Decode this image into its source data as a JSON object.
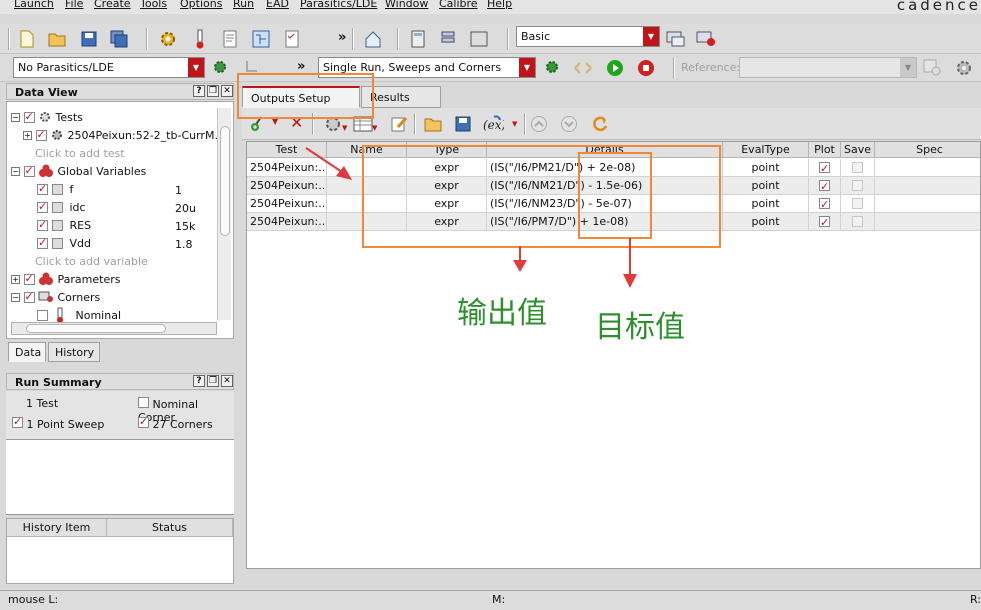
{
  "menu": [
    "Launch",
    "File",
    "Create",
    "Tools",
    "Options",
    "Run",
    "EAD",
    "Parasitics/LDE",
    "Window",
    "Calibre",
    "Help"
  ],
  "brand": "cadence",
  "toolbar1": {
    "more": "»",
    "mode_select": "Basic"
  },
  "toolbar2": {
    "parasitics_select": "No Parasitics/LDE",
    "more": "»",
    "run_select": "Single Run, Sweeps and Corners",
    "reference_label": "Reference:",
    "reference_value": ""
  },
  "data_view": {
    "title": "Data View",
    "ctrl_help": "?",
    "tests_label": "Tests",
    "test_name": "2504Peixun:52-2_tb-CurrM...",
    "add_test": "Click to add test",
    "global_vars_label": "Global Variables",
    "variables": [
      {
        "name": "f",
        "value": "1"
      },
      {
        "name": "idc",
        "value": "20u"
      },
      {
        "name": "RES",
        "value": "15k"
      },
      {
        "name": "Vdd",
        "value": "1.8"
      }
    ],
    "add_variable": "Click to add variable",
    "parameters_label": "Parameters",
    "corners_label": "Corners",
    "nominal_label": "Nominal",
    "tabs": [
      "Data",
      "History"
    ]
  },
  "run_summary": {
    "title": "Run Summary",
    "ctrl_help": "?",
    "test_count": "1 Test",
    "nominal_corner": "Nominal Corner",
    "point_sweep": "1 Point Sweep",
    "corners": "27 Corners",
    "history_headers": [
      "History Item",
      "Status"
    ]
  },
  "outputs": {
    "tabs": [
      "Outputs Setup",
      "Results"
    ],
    "headers": [
      "Test",
      "Name",
      "Type",
      "Details",
      "EvalType",
      "Plot",
      "Save",
      "Spec"
    ],
    "rows": [
      {
        "test": "2504Peixun:...",
        "name": "",
        "type": "expr",
        "details": "(IS(\"/I6/PM21/D\") + 2e-08)",
        "evaltype": "point",
        "plot": true,
        "save": false
      },
      {
        "test": "2504Peixun:...",
        "name": "",
        "type": "expr",
        "details": "(IS(\"/I6/NM21/D\") - 1.5e-06)",
        "evaltype": "point",
        "plot": true,
        "save": false
      },
      {
        "test": "2504Peixun:...",
        "name": "",
        "type": "expr",
        "details": "(IS(\"/I6/NM23/D\") - 5e-07)",
        "evaltype": "point",
        "plot": true,
        "save": false
      },
      {
        "test": "2504Peixun:...",
        "name": "",
        "type": "expr",
        "details": "(IS(\"/I6/PM7/D\") + 1e-08)",
        "evaltype": "point",
        "plot": true,
        "save": false
      }
    ]
  },
  "annotations": {
    "output_value": "输出值",
    "target_value": "目标值"
  },
  "statusbar": {
    "mouse_l": "mouse L:",
    "mouse_m": "M:",
    "mouse_r": "R:"
  },
  "colors": {
    "annotation_box": "#f0883a",
    "arrow": "#e03a3a",
    "annotation_text": "#2f8f2f",
    "check_red": "#c0141b",
    "run_green": "#1fa61f",
    "stop_red": "#d02020"
  }
}
